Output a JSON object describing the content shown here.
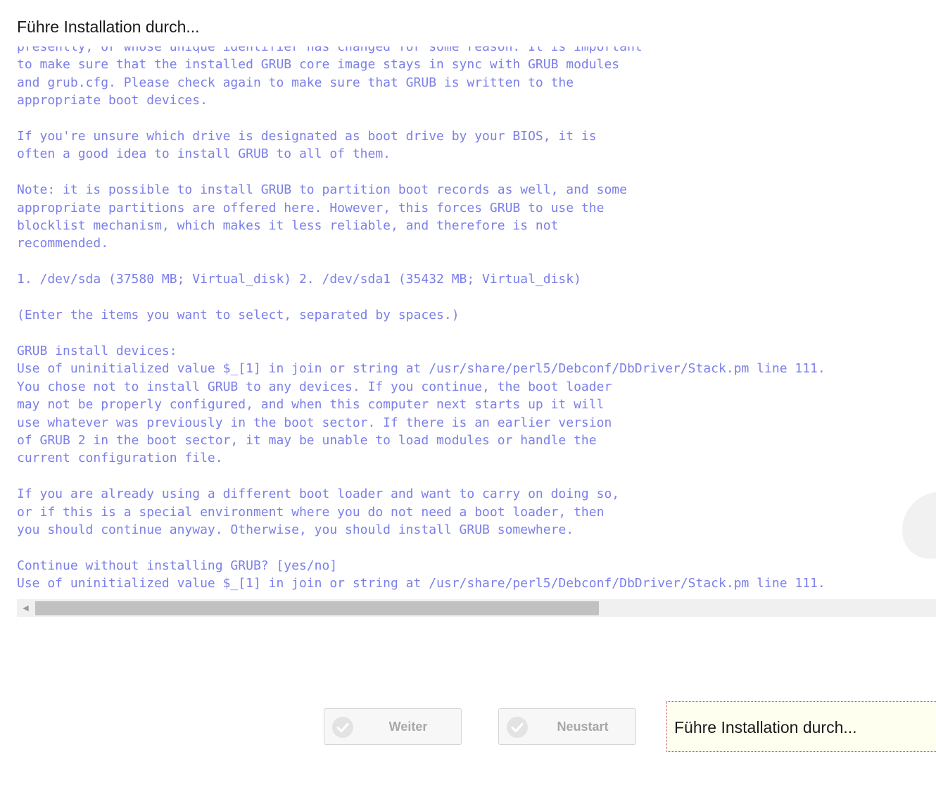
{
  "page": {
    "title": "Führe Installation durch..."
  },
  "console": {
    "text": "presently, or whose unique identifier has changed for some reason. It is important\nto make sure that the installed GRUB core image stays in sync with GRUB modules\nand grub.cfg. Please check again to make sure that GRUB is written to the\nappropriate boot devices.\n\nIf you're unsure which drive is designated as boot drive by your BIOS, it is\noften a good idea to install GRUB to all of them.\n\nNote: it is possible to install GRUB to partition boot records as well, and some\nappropriate partitions are offered here. However, this forces GRUB to use the\nblocklist mechanism, which makes it less reliable, and therefore is not\nrecommended.\n\n1. /dev/sda (37580 MB; Virtual_disk) 2. /dev/sda1 (35432 MB; Virtual_disk)\n\n(Enter the items you want to select, separated by spaces.)\n\nGRUB install devices:\nUse of uninitialized value $_[1] in join or string at /usr/share/perl5/Debconf/DbDriver/Stack.pm line 111.\nYou chose not to install GRUB to any devices. If you continue, the boot loader\nmay not be properly configured, and when this computer next starts up it will\nuse whatever was previously in the boot sector. If there is an earlier version\nof GRUB 2 in the boot sector, it may be unable to load modules or handle the\ncurrent configuration file.\n\nIf you are already using a different boot loader and want to carry on doing so,\nor if this is a special environment where you do not need a boot loader, then\nyou should continue anyway. Otherwise, you should install GRUB somewhere.\n\nContinue without installing GRUB? [yes/no]\nUse of uninitialized value $_[1] in join or string at /usr/share/perl5/Debconf/DbDriver/Stack.pm line 111."
  },
  "scrollbar": {
    "left_arrow_icon": "triangle-left-icon"
  },
  "buttons": {
    "weiter": {
      "label": "Weiter",
      "icon": "check-circle-icon",
      "enabled": false
    },
    "neustart": {
      "label": "Neustart",
      "icon": "check-circle-icon",
      "enabled": false
    }
  },
  "status": {
    "text": "Führe Installation durch..."
  },
  "colors": {
    "console_text": "#7b7fe8",
    "button_text_disabled": "#a8a8a8",
    "status_background": "#fffff0",
    "status_border": "#c94a4a"
  }
}
